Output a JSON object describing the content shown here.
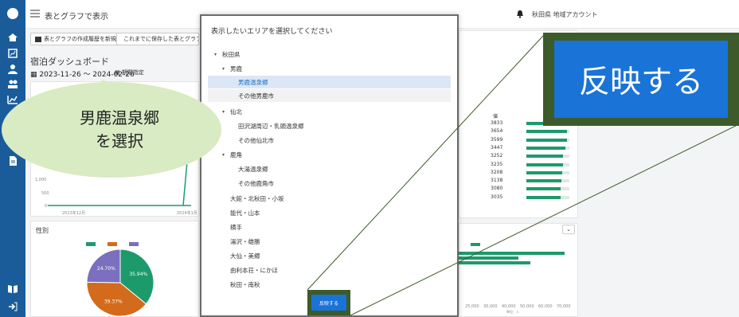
{
  "topbar": {
    "title": "表とグラフで表示",
    "user": "秋田県 地域アカウント"
  },
  "dashboard": {
    "new_button": "表とグラフの作成履歴を新規作成",
    "saved_button": "これまでに保存した表とグラフ",
    "title": "宿泊ダッシュボード",
    "date_range": "2023-11-26 ～ 2024-02-26",
    "period_label": "期間指定",
    "gender_card_title": "性別",
    "ytick_1000": "1,000",
    "ytick_500": "500",
    "ytick_0": "0",
    "xtick_start": "2023年12月",
    "xtick_end": "2024年1月",
    "rank_header": "値",
    "rank_values": [
      "3833",
      "3654",
      "3599",
      "3447",
      "3252",
      "3235",
      "3208",
      "3138",
      "3080",
      "3035"
    ],
    "bar_xticks": [
      "25,000",
      "30,000",
      "40,000",
      "50,000",
      "60,000",
      "70,000"
    ],
    "bar_xlabel": "単位：人"
  },
  "chart_data": {
    "type": "pie",
    "title": "性別",
    "legend_colors": [
      "#1d9a6c",
      "#d36b1c",
      "#7b6fbf"
    ],
    "values": [
      35.94,
      39.37,
      24.7
    ],
    "labels": [
      "35.94%",
      "39.37%",
      "24.70%"
    ],
    "colors": [
      "#1d9a6c",
      "#d36b1c",
      "#7b6fbf"
    ]
  },
  "modal": {
    "title": "表示したいエリアを選択してください",
    "apply_label": "反映する",
    "tree": [
      {
        "label": "秋田県",
        "chev": "▾"
      },
      {
        "label": "男鹿",
        "chev": "▾"
      },
      {
        "label": "男鹿温泉郷",
        "chev": ""
      },
      {
        "label": "その他男鹿市",
        "chev": ""
      },
      {
        "label": "仙北",
        "chev": "▾"
      },
      {
        "label": "田沢湖周辺・乳頭温泉郷",
        "chev": ""
      },
      {
        "label": "その他仙北市",
        "chev": ""
      },
      {
        "label": "鹿角",
        "chev": "▾"
      },
      {
        "label": "大湯温泉郷",
        "chev": ""
      },
      {
        "label": "その他鹿角市",
        "chev": ""
      },
      {
        "label": "大館・北秋田・小坂",
        "chev": ""
      },
      {
        "label": "能代・山本",
        "chev": ""
      },
      {
        "label": "横手",
        "chev": ""
      },
      {
        "label": "湯沢・雄勝",
        "chev": ""
      },
      {
        "label": "大仙・美郷",
        "chev": ""
      },
      {
        "label": "由利本荘・にかほ",
        "chev": ""
      },
      {
        "label": "秋田・南秋",
        "chev": ""
      }
    ]
  },
  "callouts": {
    "zoom_label": "反映する",
    "bubble_line1": "男鹿温泉郷",
    "bubble_line2": "を選択"
  }
}
